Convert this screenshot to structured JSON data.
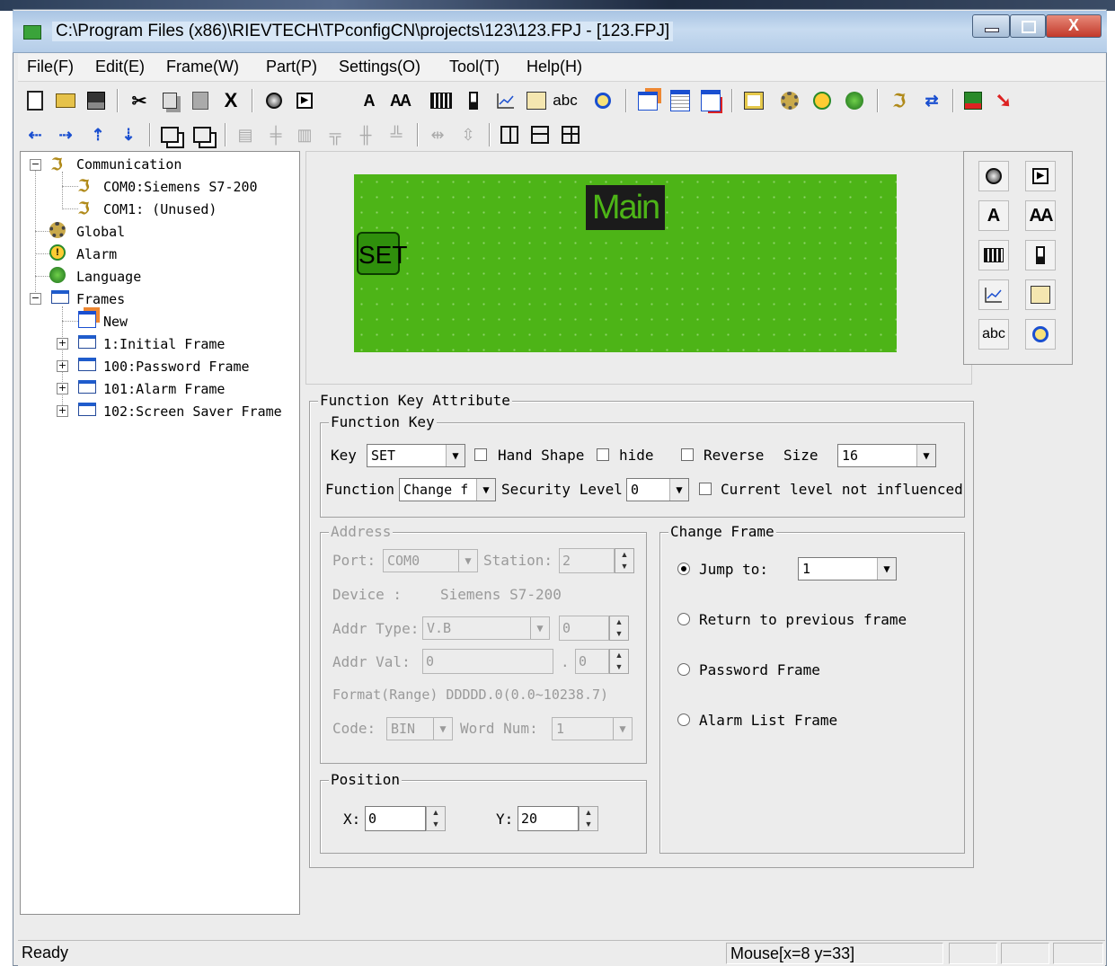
{
  "window": {
    "title": "C:\\Program Files (x86)\\RIEVTECH\\TPconfigCN\\projects\\123\\123.FPJ - [123.FPJ]",
    "close_glyph": "X"
  },
  "menu": [
    "File(F)",
    "Edit(E)",
    "Frame(W)",
    "Part(P)",
    "Settings(O)",
    "Tool(T)",
    "Help(H)"
  ],
  "toolbar": {
    "cut_glyph": "X",
    "text_a": "A",
    "text_aa": "AA",
    "text_abc": "abc"
  },
  "tree": {
    "communication": "Communication",
    "com0": "COM0:Siemens S7-200",
    "com1": "COM1: (Unused)",
    "global": "Global",
    "alarm": "Alarm",
    "language": "Language",
    "frames": "Frames",
    "new": "New",
    "frame1": "1:Initial Frame",
    "frame100": "100:Password Frame",
    "frame101": "101:Alarm Frame",
    "frame102": "102:Screen Saver Frame"
  },
  "canvas": {
    "main_label": "Main",
    "set_button": "SET"
  },
  "palette": {
    "a": "A",
    "aa": "AA",
    "abc": "abc"
  },
  "attr": {
    "group_title": "Function Key Attribute",
    "fk_title": "Function Key",
    "key_label": "Key",
    "key_value": "SET",
    "hand_shape": "Hand Shape",
    "hide": "hide",
    "reverse": "Reverse",
    "size_label": "Size",
    "size_value": "16",
    "function_label": "Function",
    "function_value": "Change f",
    "security_label": "Security Level",
    "security_value": "0",
    "current_level": "Current level not influenced",
    "address_title": "Address",
    "port_label": "Port:",
    "port_value": "COM0",
    "station_label": "Station:",
    "station_value": "2",
    "device_label": "Device :",
    "device_value": "Siemens S7-200",
    "addr_type_label": "Addr Type:",
    "addr_type_value": "V.B",
    "addr_type_num": "0",
    "addr_val_label": "Addr Val:",
    "addr_val_value": "0",
    "addr_val_dot": ".",
    "addr_val_bit": "0",
    "format": "Format(Range) DDDDD.0(0.0~10238.7)",
    "code_label": "Code:",
    "code_value": "BIN",
    "word_num_label": "Word Num:",
    "word_num_value": "1",
    "change_frame_title": "Change Frame",
    "jump_to": "Jump to:",
    "jump_value": "1",
    "return_prev": "Return to previous frame",
    "password_frame": "Password Frame",
    "alarm_list_frame": "Alarm List Frame",
    "position_title": "Position",
    "x_label": "X:",
    "x_value": "0",
    "y_label": "Y:",
    "y_value": "20"
  },
  "status": {
    "ready": "Ready",
    "mouse": "Mouse[x=8  y=33]"
  },
  "colors": {
    "canvas_green": "#4db417",
    "title_bar": "#b5cde8"
  }
}
